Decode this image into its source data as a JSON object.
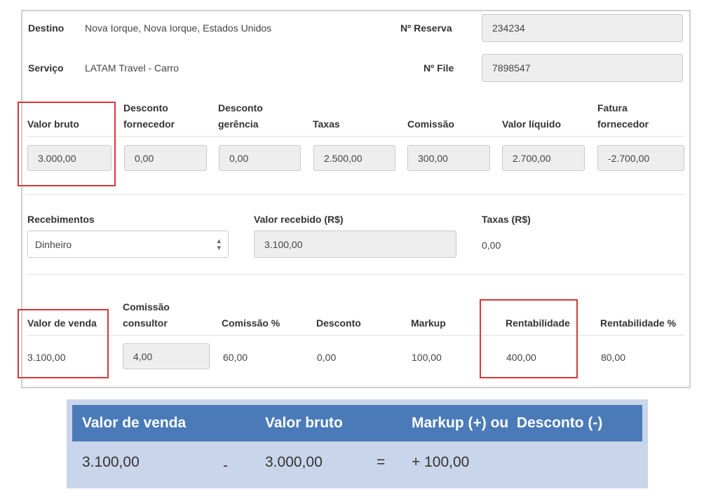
{
  "top": {
    "destino_label": "Destino",
    "destino_value": "Nova Iorque, Nova Iorque, Estados Unidos",
    "reserva_label": "Nº Reserva",
    "reserva_value": "234234",
    "servico_label": "Serviço",
    "servico_value": "LATAM Travel - Carro",
    "file_label": "Nº File",
    "file_value": "7898547"
  },
  "values_row": {
    "valor_bruto_label": "Valor bruto",
    "desconto_fornecedor_label_1": "Desconto",
    "desconto_fornecedor_label_2": "fornecedor",
    "desconto_gerencia_label_1": "Desconto",
    "desconto_gerencia_label_2": "gerência",
    "taxas_label": "Taxas",
    "comissao_label": "Comissão",
    "valor_liquido_label": "Valor líquido",
    "fatura_fornecedor_label_1": "Fatura",
    "fatura_fornecedor_label_2": "fornecedor",
    "valor_bruto": "3.000,00",
    "desconto_fornecedor": "0,00",
    "desconto_gerencia": "0,00",
    "taxas": "2.500,00",
    "comissao": "300,00",
    "valor_liquido": "2.700,00",
    "fatura_fornecedor": "-2.700,00"
  },
  "recebimentos": {
    "label": "Recebimentos",
    "selected": "Dinheiro",
    "valor_recebido_label": "Valor recebido (R$)",
    "valor_recebido": "3.100,00",
    "taxas_label": "Taxas (R$)",
    "taxas": "0,00"
  },
  "venda_row": {
    "valor_venda_label": "Valor de venda",
    "comissao_consultor_label_1": "Comissão",
    "comissao_consultor_label_2": "consultor",
    "comissao_pct_label": "Comissão %",
    "desconto_label": "Desconto",
    "markup_label": "Markup",
    "rentabilidade_label": "Rentabilidade",
    "rentabilidade_pct_label": "Rentabilidade %",
    "valor_venda": "3.100,00",
    "comissao_consultor": "4,00",
    "comissao_pct": "60,00",
    "desconto": "0,00",
    "markup": "100,00",
    "rentabilidade": "400,00",
    "rentabilidade_pct": "80,00"
  },
  "summary": {
    "h1": "Valor de venda",
    "h2": "Valor bruto",
    "h3": "Markup (+) ou  Desconto (-)",
    "v1": "3.100,00",
    "op1": "-",
    "v2": "3.000,00",
    "op2": "=",
    "v3": "+ 100,00"
  },
  "colors": {
    "highlight": "#d93636",
    "summary_header": "#4a7ab8",
    "summary_body": "#c9d5ea"
  }
}
